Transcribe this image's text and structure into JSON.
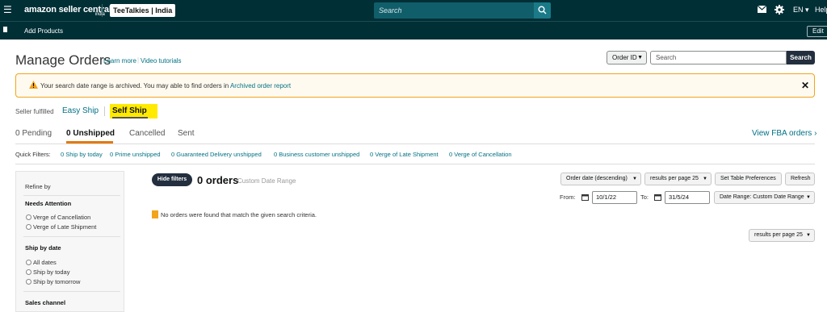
{
  "topbar": {
    "menu_icon": "hamburger-icon",
    "logo": "amazon seller central",
    "logo_region": "india",
    "store": "TeeTalkies | India",
    "search_placeholder": "Search",
    "lang": "EN ▾",
    "help": "Help"
  },
  "subbar": {
    "add_products": "Add Products",
    "edit": "Edit"
  },
  "header": {
    "title": "Manage Orders",
    "learn_more": "Learn more",
    "sep": "|",
    "video": "Video tutorials",
    "order_id": "Order ID",
    "search_placeholder": "Search",
    "search_btn": "Search"
  },
  "alert": {
    "text": "Your search date range is archived. You may able to find orders in",
    "link": "Archived order report",
    "color": "#f2a41a"
  },
  "fulfillment": {
    "label": "Seller fulfilled",
    "easy_ship": "Easy Ship",
    "self_ship": "Self Ship"
  },
  "tabs": [
    {
      "count": "0",
      "label": "Pending"
    },
    {
      "count": "0",
      "label": "Unshipped"
    },
    {
      "label": "Cancelled"
    },
    {
      "label": "Sent"
    }
  ],
  "view_fba": "View FBA orders ›",
  "quick_filters": {
    "label": "Quick Filters:",
    "items": [
      "0 Ship by today",
      "0 Prime unshipped",
      "0 Guaranteed Delivery unshipped",
      "0 Business customer unshipped",
      "0 Verge of Late Shipment",
      "0 Verge of Cancellation"
    ]
  },
  "sidebar": {
    "refine": "Refine by",
    "needs_attention": "Needs Attention",
    "needs_options": [
      "Verge of Cancellation",
      "Verge of Late Shipment"
    ],
    "ship_by": "Ship by date",
    "ship_options": [
      "All dates",
      "Ship by today",
      "Ship by tomorrow"
    ],
    "sales_channel": "Sales channel"
  },
  "results": {
    "hide_filters": "Hide filters",
    "count": "0 orders",
    "range_label": "Custom Date Range",
    "sort": "Order date (descending)",
    "per_page": "results per page 25",
    "prefs": "Set Table Preferences",
    "refresh": "Refresh",
    "from_label": "From:",
    "from": "10/1/22",
    "to_label": "To:",
    "to": "31/5/24",
    "date_range": "Date Range: Custom Date Range",
    "empty": "No orders were found that match the given search criteria.",
    "per_page_bottom": "results per page 25"
  }
}
